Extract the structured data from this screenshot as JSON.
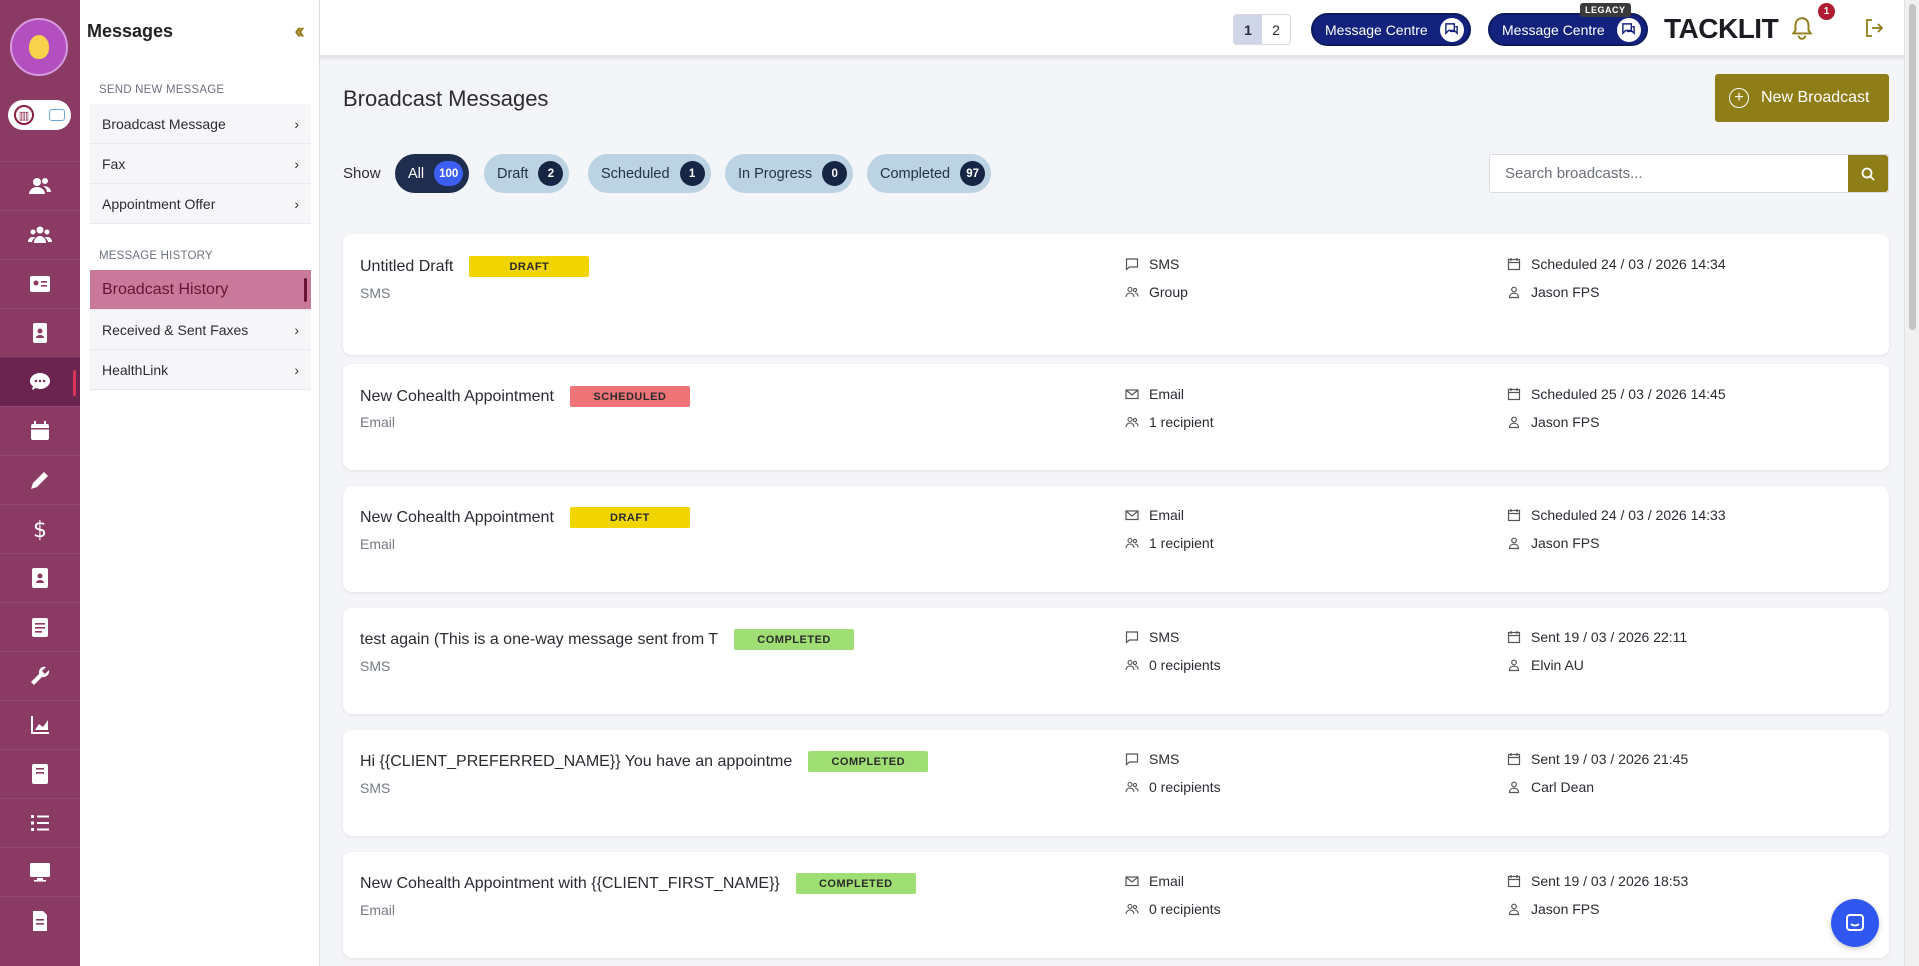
{
  "app": {
    "brand": "TACKLIT",
    "notification_count": "1"
  },
  "topbar": {
    "pages": [
      "1",
      "2"
    ],
    "message_centre_label": "Message Centre",
    "message_centre_legacy_label": "Message Centre",
    "legacy_tag": "LEGACY"
  },
  "sidebar": {
    "title": "Messages",
    "send_section": "SEND NEW MESSAGE",
    "send_items": [
      {
        "label": "Broadcast Message"
      },
      {
        "label": "Fax"
      },
      {
        "label": "Appointment Offer"
      }
    ],
    "history_section": "MESSAGE HISTORY",
    "history_items": [
      {
        "label": "Broadcast History"
      },
      {
        "label": "Received & Sent Faxes"
      },
      {
        "label": "HealthLink"
      }
    ]
  },
  "rail": {
    "icons": [
      "clients-icon",
      "groups-icon",
      "id-card-icon",
      "contacts-icon",
      "messages-icon",
      "calendar-icon",
      "pen-icon",
      "dollar-icon",
      "address-book-icon",
      "notes-icon",
      "wrench-icon",
      "chart-icon",
      "book-icon",
      "checklist-icon",
      "monitor-icon",
      "document-icon"
    ]
  },
  "main": {
    "title": "Broadcast Messages",
    "new_broadcast": "New Broadcast",
    "show_label": "Show",
    "filters": [
      {
        "label": "All",
        "count": "100"
      },
      {
        "label": "Draft",
        "count": "2"
      },
      {
        "label": "Scheduled",
        "count": "1"
      },
      {
        "label": "In Progress",
        "count": "0"
      },
      {
        "label": "Completed",
        "count": "97"
      }
    ],
    "search_placeholder": "Search broadcasts...",
    "broadcasts": [
      {
        "name": "Untitled Draft",
        "status": "DRAFT",
        "channel_sub": "SMS",
        "channel": "SMS",
        "recipients": "Group",
        "when": "Scheduled 24 / 03 / 2026 14:34",
        "author": "Jason FPS"
      },
      {
        "name": "New Cohealth Appointment",
        "status": "SCHEDULED",
        "channel_sub": "Email",
        "channel": "Email",
        "recipients": "1 recipient",
        "when": "Scheduled 25 / 03 / 2026 14:45",
        "author": "Jason FPS"
      },
      {
        "name": "New Cohealth Appointment",
        "status": "DRAFT",
        "channel_sub": "Email",
        "channel": "Email",
        "recipients": "1 recipient",
        "when": "Scheduled 24 / 03 / 2026 14:33",
        "author": "Jason FPS"
      },
      {
        "name": "test again (This is a one-way message sent from T",
        "status": "COMPLETED",
        "channel_sub": "SMS",
        "channel": "SMS",
        "recipients": "0 recipients",
        "when": "Sent 19 / 03 / 2026 22:11",
        "author": "Elvin AU"
      },
      {
        "name": "Hi {{CLIENT_PREFERRED_NAME}} You have an appointme",
        "status": "COMPLETED",
        "channel_sub": "SMS",
        "channel": "SMS",
        "recipients": "0 recipients",
        "when": "Sent 19 / 03 / 2026 21:45",
        "author": "Carl Dean"
      },
      {
        "name": "New Cohealth Appointment with {{CLIENT_FIRST_NAME}}",
        "status": "COMPLETED",
        "channel_sub": "Email",
        "channel": "Email",
        "recipients": "0 recipients",
        "when": "Sent 19 / 03 / 2026 18:53",
        "author": "Jason FPS"
      }
    ]
  },
  "colors": {
    "rail": "#8a3a63",
    "accent_gold": "#8f7d17",
    "navy": "#13237d",
    "draft": "#f0d500",
    "scheduled": "#f07378",
    "completed": "#9fde72"
  }
}
